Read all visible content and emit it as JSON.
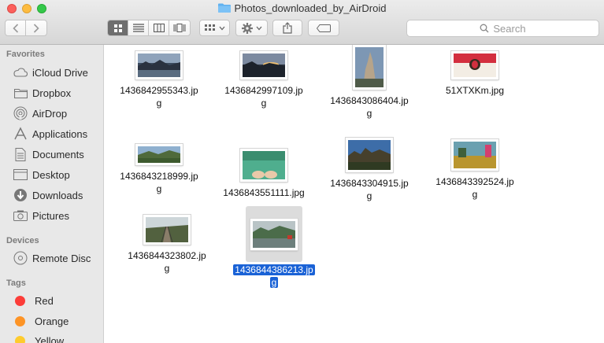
{
  "window": {
    "title": "Photos_downloaded_by_AirDroid"
  },
  "search": {
    "placeholder": "Search"
  },
  "sidebar": {
    "favorites_header": "Favorites",
    "favorites": [
      {
        "label": "iCloud Drive",
        "icon": "cloud-icon"
      },
      {
        "label": "Dropbox",
        "icon": "folder-icon"
      },
      {
        "label": "AirDrop",
        "icon": "airdrop-icon"
      },
      {
        "label": "Applications",
        "icon": "applications-icon"
      },
      {
        "label": "Documents",
        "icon": "documents-icon"
      },
      {
        "label": "Desktop",
        "icon": "desktop-icon"
      },
      {
        "label": "Downloads",
        "icon": "downloads-icon"
      },
      {
        "label": "Pictures",
        "icon": "camera-icon"
      }
    ],
    "devices_header": "Devices",
    "devices": [
      {
        "label": "Remote Disc",
        "icon": "disc-icon"
      }
    ],
    "tags_header": "Tags",
    "tags": [
      {
        "label": "Red",
        "color": "#fc3d39"
      },
      {
        "label": "Orange",
        "color": "#fd9426"
      },
      {
        "label": "Yellow",
        "color": "#fecb2e"
      }
    ]
  },
  "files": [
    {
      "name_line1": "1436842955343.jp",
      "name_line2": "g"
    },
    {
      "name_line1": "1436842997109.jp",
      "name_line2": "g"
    },
    {
      "name_line1": "1436843086404.jp",
      "name_line2": "g"
    },
    {
      "name_line1": "51XTXKm.jpg",
      "name_line2": ""
    },
    {
      "name_line1": "1436843218999.jp",
      "name_line2": "g"
    },
    {
      "name_line1": "1436843551111.jpg",
      "name_line2": ""
    },
    {
      "name_line1": "1436843304915.jp",
      "name_line2": "g"
    },
    {
      "name_line1": "1436843392524.jp",
      "name_line2": "g"
    },
    {
      "name_line1": "1436844323802.jp",
      "name_line2": "g"
    },
    {
      "name_line1": "1436844386213.jp",
      "name_line2": "g",
      "selected": true
    }
  ]
}
